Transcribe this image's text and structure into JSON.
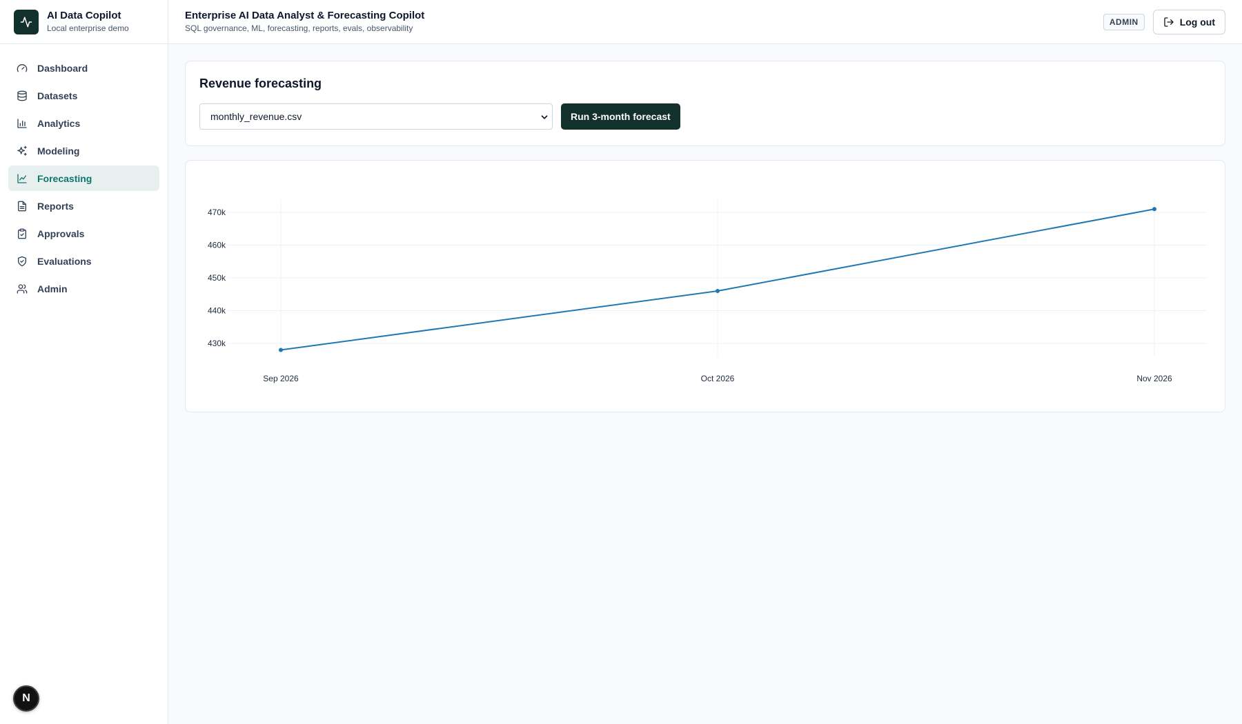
{
  "brand": {
    "title": "AI Data Copilot",
    "subtitle": "Local enterprise demo"
  },
  "header": {
    "title": "Enterprise AI Data Analyst & Forecasting Copilot",
    "subtitle": "SQL governance, ML, forecasting, reports, evals, observability",
    "role_badge": "ADMIN",
    "logout_label": "Log out"
  },
  "sidebar": {
    "items": [
      {
        "label": "Dashboard",
        "icon": "gauge-icon",
        "active": false
      },
      {
        "label": "Datasets",
        "icon": "database-icon",
        "active": false
      },
      {
        "label": "Analytics",
        "icon": "bar-chart-icon",
        "active": false
      },
      {
        "label": "Modeling",
        "icon": "sparkles-icon",
        "active": false
      },
      {
        "label": "Forecasting",
        "icon": "line-chart-icon",
        "active": true
      },
      {
        "label": "Reports",
        "icon": "file-text-icon",
        "active": false
      },
      {
        "label": "Approvals",
        "icon": "clipboard-check-icon",
        "active": false
      },
      {
        "label": "Evaluations",
        "icon": "shield-check-icon",
        "active": false
      },
      {
        "label": "Admin",
        "icon": "users-icon",
        "active": false
      }
    ]
  },
  "forecast": {
    "title": "Revenue forecasting",
    "dataset_selected": "monthly_revenue.csv",
    "run_label": "Run 3-month forecast"
  },
  "dev_badge": {
    "letter": "N"
  },
  "colors": {
    "accent": "#12302c",
    "active_nav": "#0f766e",
    "line": "#1f77b4"
  },
  "chart_data": {
    "type": "line",
    "x": [
      "Sep 2026",
      "Oct 2026",
      "Nov 2026"
    ],
    "series": [
      {
        "values": [
          428000,
          446000,
          471000
        ]
      }
    ],
    "yticks": [
      430000,
      440000,
      450000,
      460000,
      470000
    ],
    "ytick_labels": [
      "430k",
      "440k",
      "450k",
      "460k",
      "470k"
    ],
    "ylim": [
      426000,
      474000
    ],
    "grid": true,
    "title": "",
    "xlabel": "",
    "ylabel": ""
  }
}
